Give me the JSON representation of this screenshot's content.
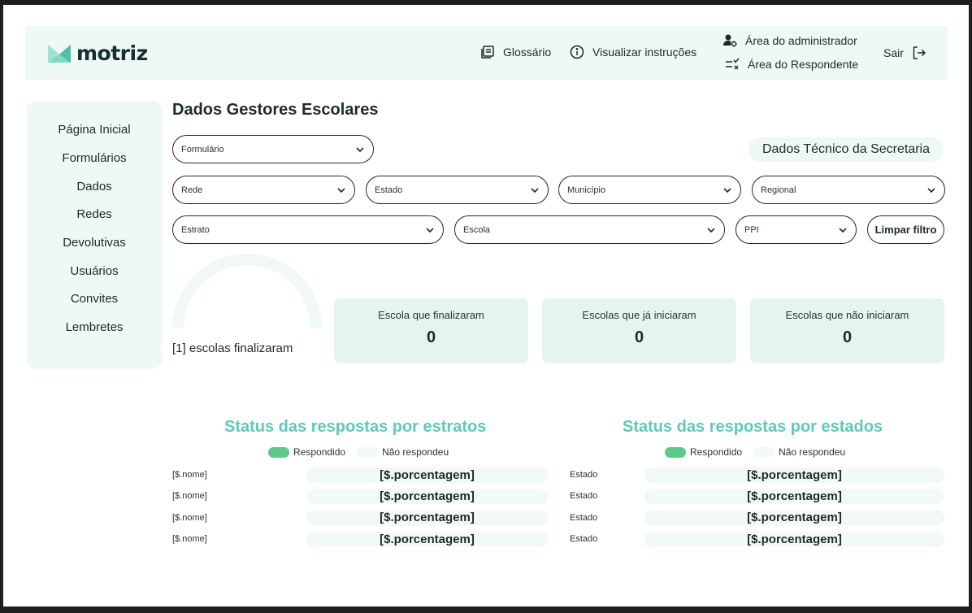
{
  "brand": {
    "name": "motriz",
    "accent": "#5fc9b8"
  },
  "header": {
    "glossary": "Glossário",
    "instructions": "Visualizar instruções",
    "admin_area": "Área do administrador",
    "respondent_area": "Área do Respondente",
    "logout": "Sair"
  },
  "sidebar": {
    "items": [
      {
        "label": "Página Inicial"
      },
      {
        "label": "Formulários"
      },
      {
        "label": "Dados"
      },
      {
        "label": "Redes"
      },
      {
        "label": "Devolutivas"
      },
      {
        "label": "Usuários"
      },
      {
        "label": "Convites"
      },
      {
        "label": "Lembretes"
      }
    ]
  },
  "main": {
    "title": "Dados Gestores Escolares",
    "tech_data": "Dados Técnico da Secretaria",
    "filters": {
      "formulario": "Formulário",
      "rede": "Rede",
      "estado": "Estado",
      "municipio": "Município",
      "regional": "Regional",
      "estrato": "Estrato",
      "escola": "Escola",
      "ppi": "PPI",
      "clear": "Limpar filtro"
    },
    "gauge_label": "[1] escolas finalizaram",
    "cards": [
      {
        "title": "Escola que finalizaram",
        "value": "0"
      },
      {
        "title": "Escolas que já iniciaram",
        "value": "0"
      },
      {
        "title": "Escolas que não iniciaram",
        "value": "0"
      }
    ]
  },
  "legend": {
    "responded": "Respondido",
    "not_responded": "Não respondeu",
    "responded_color": "#5cc98a",
    "not_responded_color": "#f2faf8"
  },
  "strata_chart": {
    "title": "Status das respostas por estratos",
    "rows": [
      {
        "label": "[$.nome]",
        "value": "[$.porcentagem]"
      },
      {
        "label": "[$.nome]",
        "value": "[$.porcentagem]"
      },
      {
        "label": "[$.nome]",
        "value": "[$.porcentagem]"
      },
      {
        "label": "[$.nome]",
        "value": "[$.porcentagem]"
      }
    ]
  },
  "states_chart": {
    "title": "Status das respostas por estados",
    "rows": [
      {
        "label": "Estado",
        "value": "[$.porcentagem]"
      },
      {
        "label": "Estado",
        "value": "[$.porcentagem]"
      },
      {
        "label": "Estado",
        "value": "[$.porcentagem]"
      },
      {
        "label": "Estado",
        "value": "[$.porcentagem]"
      }
    ]
  }
}
